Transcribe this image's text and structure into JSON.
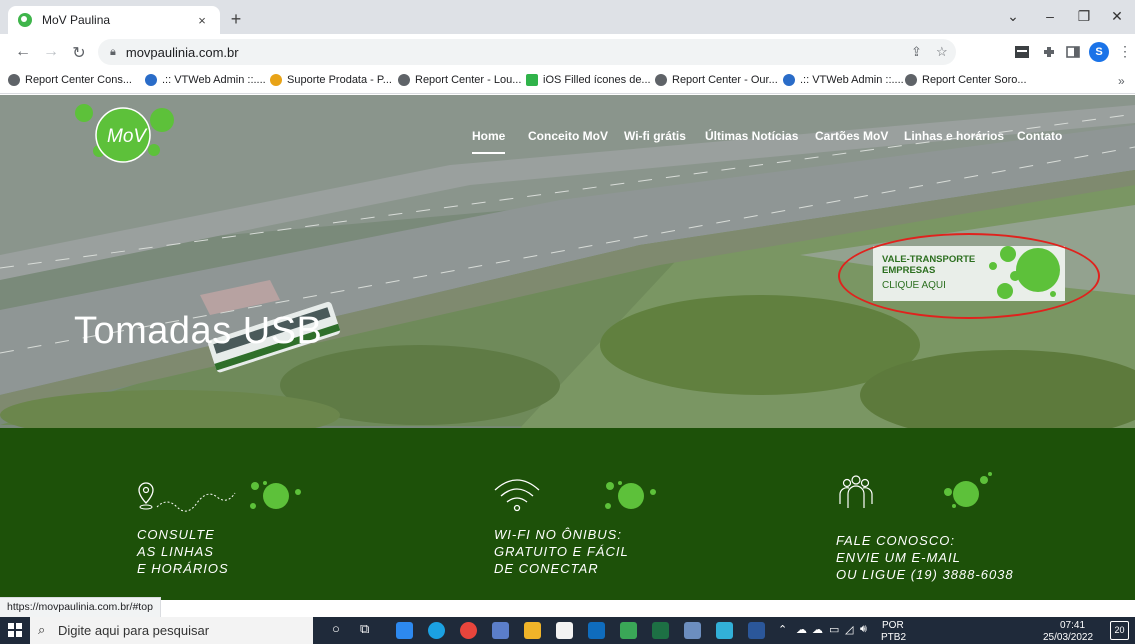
{
  "browser": {
    "tab_title": "MoV Paulina",
    "tab_close": "×",
    "new_tab": "+",
    "url": "movpaulinia.com.br",
    "profile_initial": "S",
    "bookmarks": [
      {
        "label": "Report Center Cons...",
        "color": "#5f6368"
      },
      {
        "label": ".:: VTWeb Admin ::....",
        "color": "#2a6cc8"
      },
      {
        "label": "Suporte Prodata - P...",
        "color": "#e8a317"
      },
      {
        "label": "Report Center - Lou...",
        "color": "#5f6368"
      },
      {
        "label": "iOS Filled ícones de...",
        "color": "#30b34a"
      },
      {
        "label": "Report Center - Our...",
        "color": "#5f6368"
      },
      {
        "label": ".:: VTWeb Admin ::....",
        "color": "#2a6cc8"
      },
      {
        "label": "Report Center Soro...",
        "color": "#5f6368"
      }
    ],
    "bookmarks_more": "»",
    "status_url": "https://movpaulinia.com.br/#top"
  },
  "site": {
    "logo_text": "MoV",
    "nav": [
      "Home",
      "Conceito MoV",
      "Wi-fi grátis",
      "Últimas Notícias",
      "Cartões MoV",
      "Linhas e horários",
      "Contato"
    ],
    "hero_title": "Tomadas USB",
    "vt_banner": {
      "line1": "VALE-TRANSPORTE",
      "line2": "EMPRESAS",
      "cta": "CLIQUE AQUI"
    },
    "features": [
      {
        "icon": "map-pin-route-icon",
        "lines": [
          "CONSULTE",
          "AS LINHAS",
          "E HORÁRIOS"
        ]
      },
      {
        "icon": "wifi-icon",
        "lines": [
          "WI-FI NO ÔNIBUS:",
          "GRATUITO E FÁCIL",
          "DE CONECTAR"
        ]
      },
      {
        "icon": "people-group-icon",
        "lines": [
          "FALE CONOSCO:",
          "ENVIE UM E-MAIL",
          "OU LIGUE (19) 3888-6038"
        ]
      }
    ],
    "brand_green": "#1d5109",
    "accent_green": "#5dc13a",
    "highlight_red": "#e0221d"
  },
  "taskbar": {
    "search_placeholder": "Digite aqui para pesquisar",
    "language": "POR",
    "layout": "PTB2",
    "time": "07:41",
    "date": "25/03/2022",
    "notifications": "20"
  }
}
